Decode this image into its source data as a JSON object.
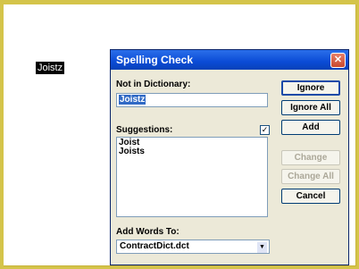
{
  "document": {
    "highlighted_word": "Joistz"
  },
  "dialog": {
    "title": "Spelling Check",
    "close_icon": "close-icon",
    "not_in_dictionary_label": "Not in Dictionary:",
    "not_in_dictionary_value": "Joistz",
    "suggestions_label": "Suggestions:",
    "suggestions_checked": true,
    "suggestions": [
      "Joist",
      "Joists"
    ],
    "add_words_label": "Add Words To:",
    "add_words_value": "ContractDict.dct",
    "buttons": {
      "ignore": "Ignore",
      "ignore_all": "Ignore All",
      "add": "Add",
      "change": "Change",
      "change_all": "Change All",
      "cancel": "Cancel"
    }
  },
  "colors": {
    "background": "#d4c44a",
    "titlebar": "#0a4bd6",
    "selection": "#316ac5"
  }
}
